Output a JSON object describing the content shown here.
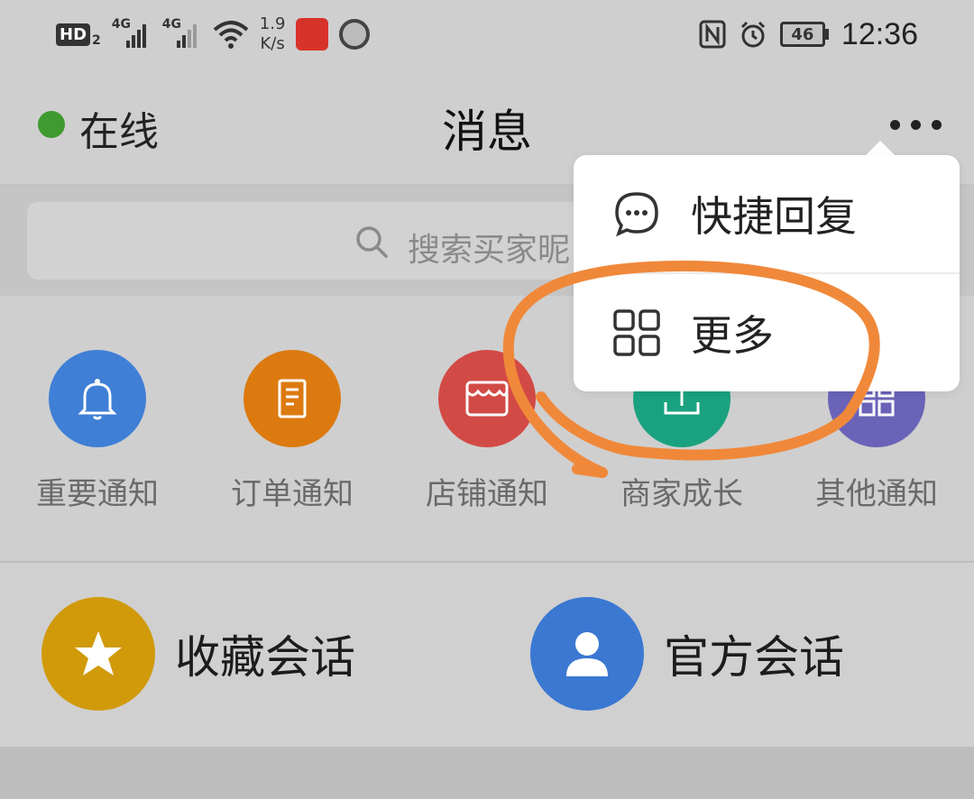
{
  "status_bar": {
    "hd": "HD",
    "hd_sub": "2",
    "signal1_label": "4G",
    "signal2_label": "4G",
    "speed_value": "1.9",
    "speed_unit": "K/s",
    "battery": "46",
    "time": "12:36",
    "icons": [
      "nfc-icon",
      "alarm-icon",
      "wifi-icon"
    ]
  },
  "header": {
    "status_label": "在线",
    "status_color": "#3f9a2f",
    "title": "消息",
    "more_icon": "more-dots-icon"
  },
  "search": {
    "placeholder": "搜索买家昵"
  },
  "notifications": [
    {
      "label": "重要通知",
      "icon": "bell-icon",
      "color": "#3f7fd6"
    },
    {
      "label": "订单通知",
      "icon": "document-icon",
      "color": "#dc7a10"
    },
    {
      "label": "店铺通知",
      "icon": "shop-icon",
      "color": "#d24a46"
    },
    {
      "label": "商家成长",
      "icon": "growth-icon",
      "color": "#1aa280"
    },
    {
      "label": "其他通知",
      "icon": "grid-icon",
      "color": "#6a63b8"
    }
  ],
  "sessions": [
    {
      "label": "收藏会话",
      "icon": "star-icon",
      "color": "#d09a0b"
    },
    {
      "label": "官方会话",
      "icon": "person-icon",
      "color": "#3a78d2"
    }
  ],
  "popup_menu": {
    "items": [
      {
        "label": "快捷回复",
        "icon": "chat-bubble-icon"
      },
      {
        "label": "更多",
        "icon": "grid-four-icon"
      }
    ]
  },
  "annotation": {
    "color": "#f0883a",
    "target": "更多"
  }
}
